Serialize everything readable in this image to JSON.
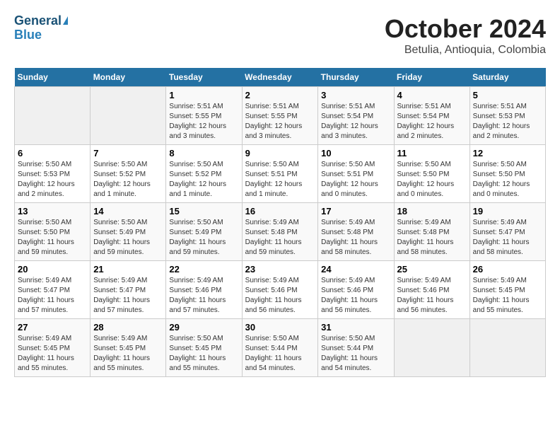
{
  "header": {
    "logo_line1": "General",
    "logo_line2": "Blue",
    "title": "October 2024",
    "subtitle": "Betulia, Antioquia, Colombia"
  },
  "days_of_week": [
    "Sunday",
    "Monday",
    "Tuesday",
    "Wednesday",
    "Thursday",
    "Friday",
    "Saturday"
  ],
  "weeks": [
    [
      {
        "day": "",
        "info": ""
      },
      {
        "day": "",
        "info": ""
      },
      {
        "day": "1",
        "info": "Sunrise: 5:51 AM\nSunset: 5:55 PM\nDaylight: 12 hours and 3 minutes."
      },
      {
        "day": "2",
        "info": "Sunrise: 5:51 AM\nSunset: 5:55 PM\nDaylight: 12 hours and 3 minutes."
      },
      {
        "day": "3",
        "info": "Sunrise: 5:51 AM\nSunset: 5:54 PM\nDaylight: 12 hours and 3 minutes."
      },
      {
        "day": "4",
        "info": "Sunrise: 5:51 AM\nSunset: 5:54 PM\nDaylight: 12 hours and 2 minutes."
      },
      {
        "day": "5",
        "info": "Sunrise: 5:51 AM\nSunset: 5:53 PM\nDaylight: 12 hours and 2 minutes."
      }
    ],
    [
      {
        "day": "6",
        "info": "Sunrise: 5:50 AM\nSunset: 5:53 PM\nDaylight: 12 hours and 2 minutes."
      },
      {
        "day": "7",
        "info": "Sunrise: 5:50 AM\nSunset: 5:52 PM\nDaylight: 12 hours and 1 minute."
      },
      {
        "day": "8",
        "info": "Sunrise: 5:50 AM\nSunset: 5:52 PM\nDaylight: 12 hours and 1 minute."
      },
      {
        "day": "9",
        "info": "Sunrise: 5:50 AM\nSunset: 5:51 PM\nDaylight: 12 hours and 1 minute."
      },
      {
        "day": "10",
        "info": "Sunrise: 5:50 AM\nSunset: 5:51 PM\nDaylight: 12 hours and 0 minutes."
      },
      {
        "day": "11",
        "info": "Sunrise: 5:50 AM\nSunset: 5:50 PM\nDaylight: 12 hours and 0 minutes."
      },
      {
        "day": "12",
        "info": "Sunrise: 5:50 AM\nSunset: 5:50 PM\nDaylight: 12 hours and 0 minutes."
      }
    ],
    [
      {
        "day": "13",
        "info": "Sunrise: 5:50 AM\nSunset: 5:50 PM\nDaylight: 11 hours and 59 minutes."
      },
      {
        "day": "14",
        "info": "Sunrise: 5:50 AM\nSunset: 5:49 PM\nDaylight: 11 hours and 59 minutes."
      },
      {
        "day": "15",
        "info": "Sunrise: 5:50 AM\nSunset: 5:49 PM\nDaylight: 11 hours and 59 minutes."
      },
      {
        "day": "16",
        "info": "Sunrise: 5:49 AM\nSunset: 5:48 PM\nDaylight: 11 hours and 59 minutes."
      },
      {
        "day": "17",
        "info": "Sunrise: 5:49 AM\nSunset: 5:48 PM\nDaylight: 11 hours and 58 minutes."
      },
      {
        "day": "18",
        "info": "Sunrise: 5:49 AM\nSunset: 5:48 PM\nDaylight: 11 hours and 58 minutes."
      },
      {
        "day": "19",
        "info": "Sunrise: 5:49 AM\nSunset: 5:47 PM\nDaylight: 11 hours and 58 minutes."
      }
    ],
    [
      {
        "day": "20",
        "info": "Sunrise: 5:49 AM\nSunset: 5:47 PM\nDaylight: 11 hours and 57 minutes."
      },
      {
        "day": "21",
        "info": "Sunrise: 5:49 AM\nSunset: 5:47 PM\nDaylight: 11 hours and 57 minutes."
      },
      {
        "day": "22",
        "info": "Sunrise: 5:49 AM\nSunset: 5:46 PM\nDaylight: 11 hours and 57 minutes."
      },
      {
        "day": "23",
        "info": "Sunrise: 5:49 AM\nSunset: 5:46 PM\nDaylight: 11 hours and 56 minutes."
      },
      {
        "day": "24",
        "info": "Sunrise: 5:49 AM\nSunset: 5:46 PM\nDaylight: 11 hours and 56 minutes."
      },
      {
        "day": "25",
        "info": "Sunrise: 5:49 AM\nSunset: 5:46 PM\nDaylight: 11 hours and 56 minutes."
      },
      {
        "day": "26",
        "info": "Sunrise: 5:49 AM\nSunset: 5:45 PM\nDaylight: 11 hours and 55 minutes."
      }
    ],
    [
      {
        "day": "27",
        "info": "Sunrise: 5:49 AM\nSunset: 5:45 PM\nDaylight: 11 hours and 55 minutes."
      },
      {
        "day": "28",
        "info": "Sunrise: 5:49 AM\nSunset: 5:45 PM\nDaylight: 11 hours and 55 minutes."
      },
      {
        "day": "29",
        "info": "Sunrise: 5:50 AM\nSunset: 5:45 PM\nDaylight: 11 hours and 55 minutes."
      },
      {
        "day": "30",
        "info": "Sunrise: 5:50 AM\nSunset: 5:44 PM\nDaylight: 11 hours and 54 minutes."
      },
      {
        "day": "31",
        "info": "Sunrise: 5:50 AM\nSunset: 5:44 PM\nDaylight: 11 hours and 54 minutes."
      },
      {
        "day": "",
        "info": ""
      },
      {
        "day": "",
        "info": ""
      }
    ]
  ]
}
